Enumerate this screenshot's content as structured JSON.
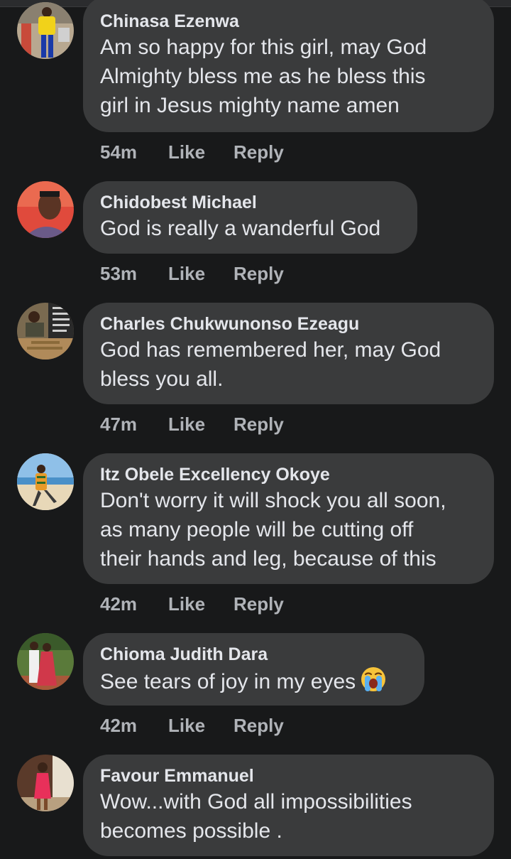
{
  "comments": [
    {
      "author": "Chinasa Ezenwa",
      "lines": [
        "Am so happy for this girl, may God",
        "Almighty bless me as he bless this",
        "girl in Jesus mighty name amen"
      ],
      "time": "54m",
      "like_label": "Like",
      "reply_label": "Reply",
      "avatar_icon": "person-yellow-photo",
      "avatar_colors": [
        "#b8a890",
        "#f1d21a"
      ]
    },
    {
      "author": "Chidobest Michael",
      "lines": [
        "God is really a wanderful God"
      ],
      "time": "53m",
      "like_label": "Like",
      "reply_label": "Reply",
      "avatar_icon": "person-selfie-photo",
      "avatar_colors": [
        "#e04a3c",
        "#6a5a88"
      ]
    },
    {
      "author": "Charles Chukwunonso Ezeagu",
      "lines": [
        "God has remembered her, may God",
        "bless you all."
      ],
      "time": "47m",
      "like_label": "Like",
      "reply_label": "Reply",
      "avatar_icon": "group-photo",
      "avatar_colors": [
        "#7a6a50",
        "#2a2a2a"
      ]
    },
    {
      "author": "Itz Obele Excellency Okoye",
      "lines": [
        "Don't worry it will shock you all soon,",
        "as many people will be cutting off",
        "their hands and leg, because of this"
      ],
      "time": "42m",
      "like_label": "Like",
      "reply_label": "Reply",
      "avatar_icon": "person-beach-photo",
      "avatar_colors": [
        "#8fc0e8",
        "#e89a2a"
      ]
    },
    {
      "author": "Chioma Judith Dara",
      "lines": [
        "See tears of joy in my eyes"
      ],
      "emoji": "loudly-crying-face-emoji",
      "time": "42m",
      "like_label": "Like",
      "reply_label": "Reply",
      "avatar_icon": "couple-photo",
      "avatar_colors": [
        "#5a7a3a",
        "#d0384a"
      ]
    },
    {
      "author": "Favour Emmanuel",
      "lines": [
        "Wow...with God all impossibilities",
        "becomes possible ."
      ],
      "avatar_icon": "person-pink-photo",
      "avatar_colors": [
        "#5a3a2a",
        "#e8305a"
      ]
    }
  ],
  "colors": {
    "background": "#18191a",
    "bubble": "#3a3b3c",
    "text": "#e4e6eb",
    "meta": "#b0b3b8"
  }
}
